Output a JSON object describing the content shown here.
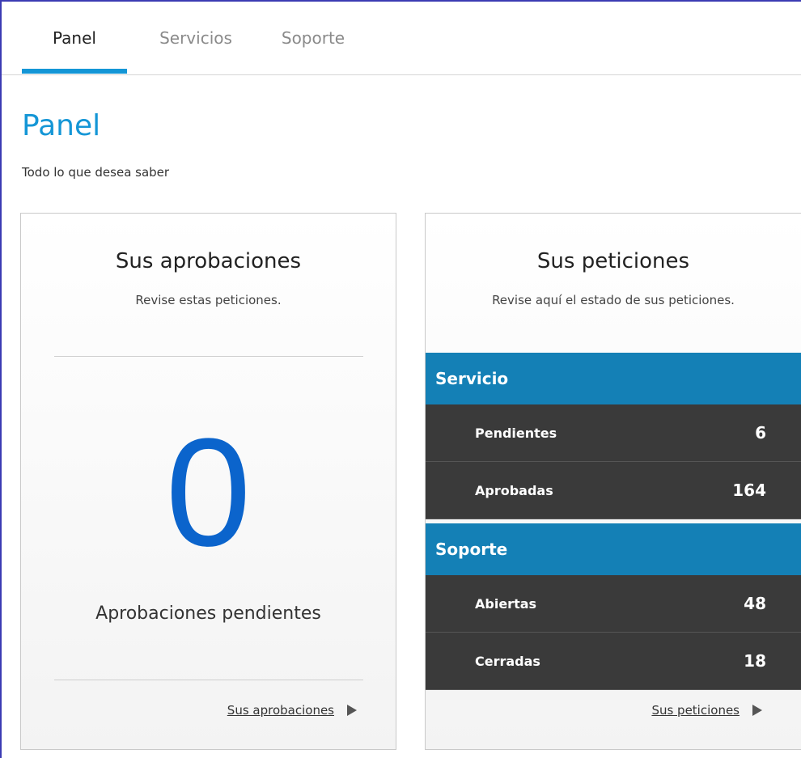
{
  "nav": {
    "tabs": [
      {
        "label": "Panel",
        "active": true
      },
      {
        "label": "Servicios",
        "active": false
      },
      {
        "label": "Soporte",
        "active": false
      }
    ],
    "accent_color": "#1496d6"
  },
  "page": {
    "title": "Panel",
    "subtitle": "Todo lo que desea saber"
  },
  "approvals": {
    "title": "Sus aprobaciones",
    "description": "Revise estas peticiones.",
    "count": "0",
    "count_label": "Aprobaciones pendientes",
    "link_label": "Sus aprobaciones",
    "count_color": "#0b64cc"
  },
  "requests": {
    "title": "Sus peticiones",
    "description": "Revise aquí el estado de sus peticiones.",
    "sections": [
      {
        "heading": "Servicio",
        "rows": [
          {
            "label": "Pendientes",
            "value": "6"
          },
          {
            "label": "Aprobadas",
            "value": "164"
          }
        ]
      },
      {
        "heading": "Soporte",
        "rows": [
          {
            "label": "Abiertas",
            "value": "48"
          },
          {
            "label": "Cerradas",
            "value": "18"
          }
        ]
      }
    ],
    "link_label": "Sus peticiones",
    "section_color": "#1480b6",
    "row_color": "#3a3a3a"
  }
}
